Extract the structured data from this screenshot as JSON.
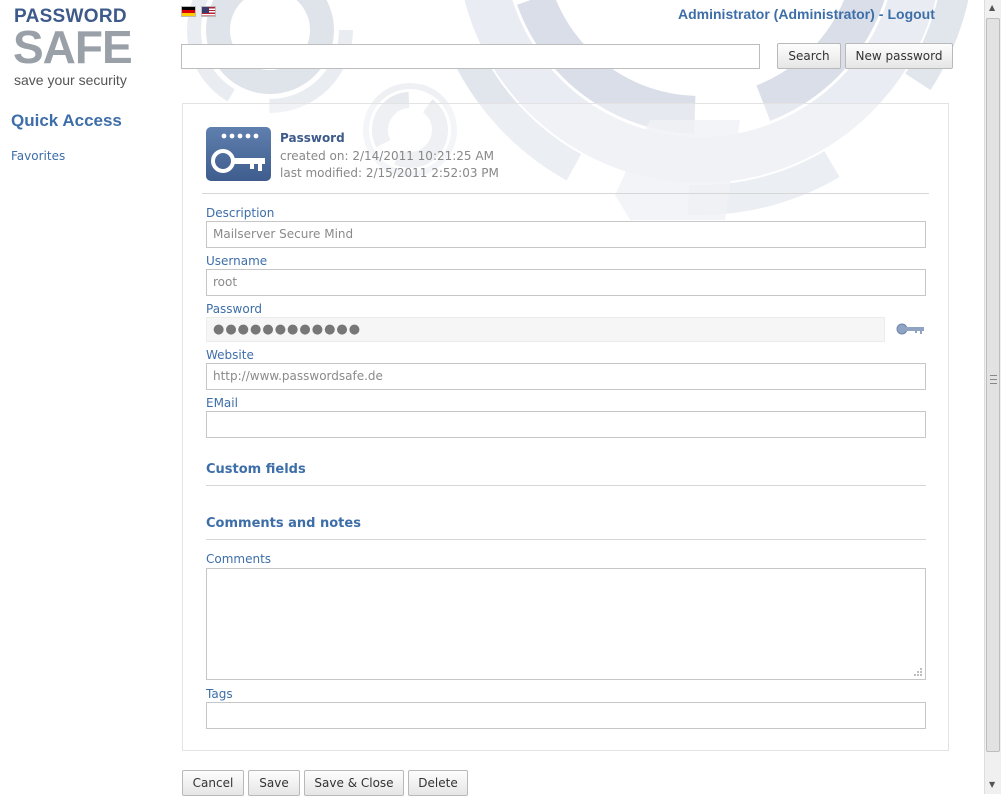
{
  "logo": {
    "line1": "PASSWORD",
    "line2": "SAFE",
    "tagline": "save your security"
  },
  "sidebar": {
    "title": "Quick Access",
    "items": [
      {
        "label": "Favorites"
      }
    ]
  },
  "header": {
    "flags": [
      {
        "name": "german-flag-icon"
      },
      {
        "name": "us-flag-icon"
      }
    ],
    "user": "Administrator (Administrator)",
    "separator": "-",
    "logout": "Logout",
    "search_value": "",
    "search_button": "Search",
    "new_password_button": "New password"
  },
  "entry": {
    "title": "Password",
    "created": "created on: 2/14/2011 10:21:25 AM",
    "modified": "last modified: 2/15/2011 2:52:03 PM"
  },
  "fields": {
    "description_label": "Description",
    "description_value": "Mailserver Secure Mind",
    "username_label": "Username",
    "username_value": "root",
    "password_label": "Password",
    "password_value": "●●●●●●●●●●●●",
    "website_label": "Website",
    "website_value": "http://www.passwordsafe.de",
    "email_label": "EMail",
    "email_value": ""
  },
  "sections": {
    "custom_fields": "Custom fields",
    "comments_notes": "Comments and notes",
    "comments_label": "Comments",
    "tags_label": "Tags"
  },
  "footer": {
    "cancel": "Cancel",
    "save": "Save",
    "save_close": "Save & Close",
    "delete": "Delete"
  },
  "colors": {
    "accent": "#3d6ea8",
    "brand_dark": "#3d5a8a",
    "logo_gray": "#9aa0a8"
  }
}
